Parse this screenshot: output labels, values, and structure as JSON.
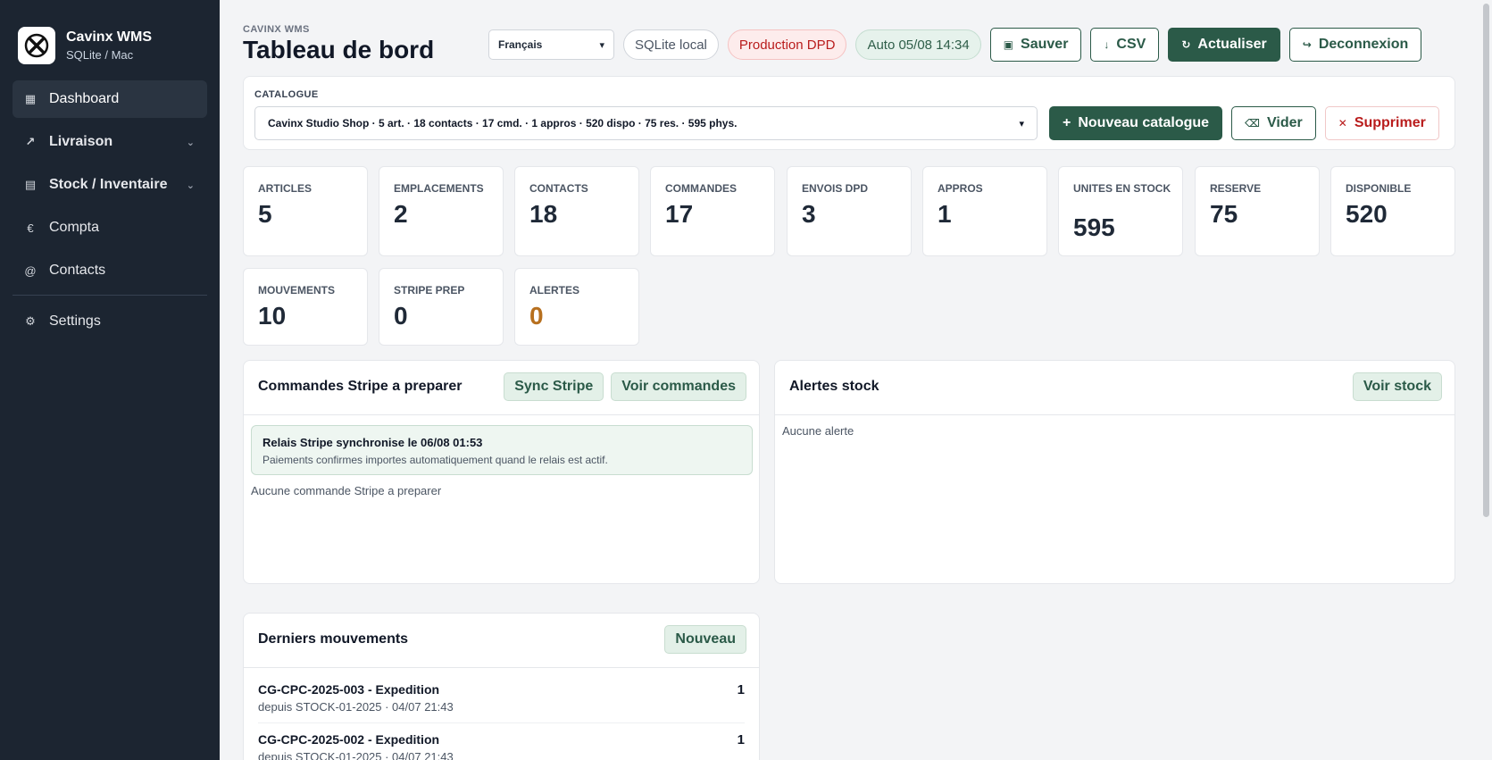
{
  "app": {
    "name": "Cavinx WMS",
    "subtitle": "SQLite / Mac"
  },
  "sidebar": {
    "items": [
      {
        "label": "Dashboard",
        "icon": "grid-icon",
        "active": true
      },
      {
        "label": "Livraison",
        "icon": "arrow-up-right-icon",
        "caret": "⌄"
      },
      {
        "label": "Stock / Inventaire",
        "icon": "list-icon",
        "caret": "⌄"
      },
      {
        "label": "Compta",
        "icon": "euro-icon"
      },
      {
        "label": "Contacts",
        "icon": "at-icon"
      },
      {
        "label": "Settings",
        "icon": "gear-icon"
      }
    ]
  },
  "header": {
    "eyebrow": "CAVINX WMS",
    "title": "Tableau de bord",
    "language": "Français",
    "db_pill": "SQLite local",
    "env_pill": "Production DPD",
    "auto_pill": "Auto 05/08 14:34",
    "save_label": "Sauver",
    "csv_label": "CSV",
    "refresh_label": "Actualiser",
    "logout_label": "Deconnexion"
  },
  "catalogue": {
    "label": "CATALOGUE",
    "selected": "Cavinx Studio Shop · 5 art. · 18 contacts · 17 cmd. · 1 appros · 520 dispo · 75 res. · 595 phys.",
    "new_label": "Nouveau catalogue",
    "clear_label": "Vider",
    "delete_label": "Supprimer"
  },
  "stats": [
    {
      "label": "ARTICLES",
      "value": "5"
    },
    {
      "label": "EMPLACEMENTS",
      "value": "2"
    },
    {
      "label": "CONTACTS",
      "value": "18"
    },
    {
      "label": "COMMANDES",
      "value": "17"
    },
    {
      "label": "ENVOIS DPD",
      "value": "3"
    },
    {
      "label": "APPROS",
      "value": "1"
    },
    {
      "label": "UNITES EN STOCK",
      "value": "595"
    },
    {
      "label": "RESERVE",
      "value": "75"
    },
    {
      "label": "DISPONIBLE",
      "value": "520"
    },
    {
      "label": "MOUVEMENTS",
      "value": "10"
    },
    {
      "label": "STRIPE PREP",
      "value": "0"
    },
    {
      "label": "ALERTES",
      "value": "0"
    }
  ],
  "colors": {
    "accent": "#2b5a48",
    "sidebar": "#1c2531",
    "alert_value": "#b7701f"
  },
  "stripe_panel": {
    "title": "Commandes Stripe a preparer",
    "sync_label": "Sync Stripe",
    "view_label": "Voir commandes",
    "notice_title": "Relais Stripe synchronise le 06/08 01:53",
    "notice_text": "Paiements confirmes importes automatiquement quand le relais est actif.",
    "empty": "Aucune commande Stripe a preparer"
  },
  "alerts_panel": {
    "title": "Alertes stock",
    "view_label": "Voir stock",
    "empty": "Aucune alerte"
  },
  "movements_panel": {
    "title": "Derniers mouvements",
    "new_label": "Nouveau",
    "rows": [
      {
        "title": "CG-CPC-2025-003 - Expedition",
        "sub": "depuis STOCK-01-2025 · 04/07 21:43",
        "qty": "1"
      },
      {
        "title": "CG-CPC-2025-002 - Expedition",
        "sub": "depuis STOCK-01-2025 · 04/07 21:43",
        "qty": "1"
      }
    ]
  }
}
